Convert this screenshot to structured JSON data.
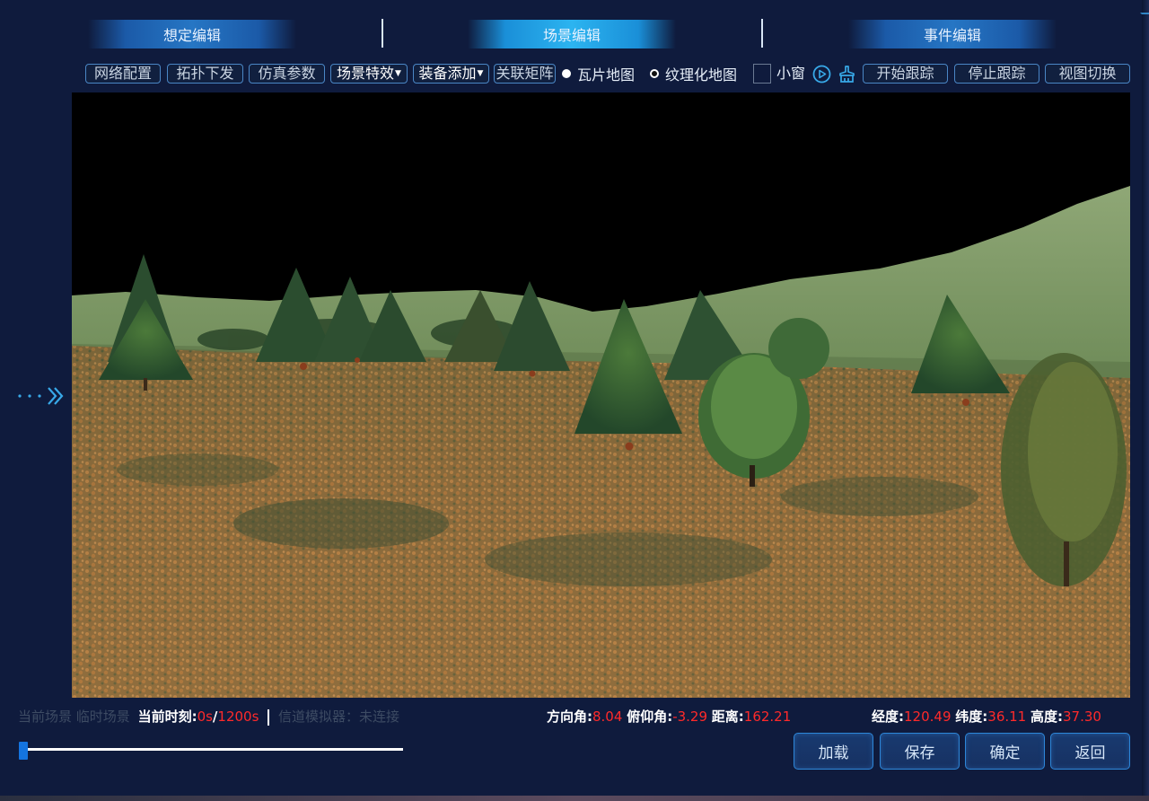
{
  "tabs": [
    {
      "label": "想定编辑",
      "active": false
    },
    {
      "label": "场景编辑",
      "active": true
    },
    {
      "label": "事件编辑",
      "active": false
    }
  ],
  "toolbar": {
    "network_config": "网络配置",
    "topology_dispatch": "拓扑下发",
    "sim_params": "仿真参数",
    "scene_effects": "场景特效",
    "equipment_add": "装备添加",
    "assoc_matrix": "关联矩阵",
    "tile_map": "瓦片地图",
    "textured_map": "纹理化地图",
    "small_window": "小窗",
    "start_tracking": "开始跟踪",
    "stop_tracking": "停止跟踪",
    "view_switch": "视图切换",
    "selected_map": "tile_map"
  },
  "icons": {
    "expand": "chevron-right-icon",
    "play": "play-circle-icon",
    "brush": "brush-icon"
  },
  "status": {
    "scene_label": "当前场景 临时场景",
    "time_label": "当前时刻:",
    "time_current": "0s",
    "time_sep": "/",
    "time_total": "1200s",
    "channel_label": "信道模拟器：未连接",
    "azimuth_label": "方向角:",
    "azimuth_value": "8.04",
    "pitch_label": "俯仰角:",
    "pitch_value": "-3.29",
    "distance_label": "距离:",
    "distance_value": "162.21",
    "lon_label": "经度:",
    "lon_value": "120.49",
    "lat_label": "纬度:",
    "lat_value": "36.11",
    "alt_label": "高度:",
    "alt_value": "37.30",
    "timeline_progress": 0
  },
  "actions": {
    "load": "加载",
    "save": "保存",
    "confirm": "确定",
    "back": "返回"
  },
  "colors": {
    "accent": "#2cb4f0",
    "value_red": "#ff2a2a",
    "background": "#0f1b3d"
  }
}
